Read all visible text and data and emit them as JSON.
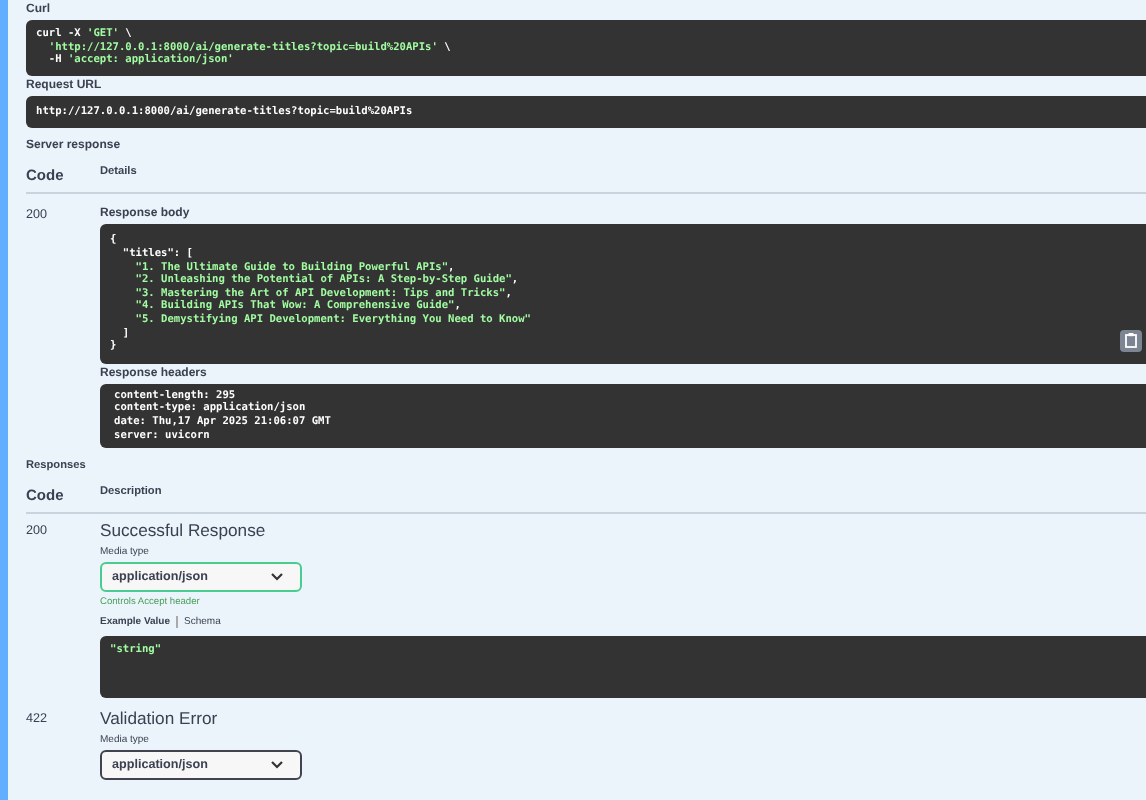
{
  "curl": {
    "label": "Curl",
    "lines": [
      [
        {
          "text": "curl -X ",
          "kind": "plain"
        },
        {
          "text": "'GET'",
          "kind": "string"
        },
        {
          "text": " \\",
          "kind": "plain"
        }
      ],
      [
        {
          "text": "  'http://127.0.0.1:8000/ai/generate-titles?topic=build%20APIs'",
          "kind": "string"
        },
        {
          "text": " \\",
          "kind": "plain"
        }
      ],
      [
        {
          "text": "  -H ",
          "kind": "plain"
        },
        {
          "text": "'accept: application/json'",
          "kind": "string"
        }
      ]
    ]
  },
  "request_url": {
    "label": "Request URL",
    "value": "http://127.0.0.1:8000/ai/generate-titles?topic=build%20APIs"
  },
  "server_response": {
    "label": "Server response",
    "columns": [
      "Code",
      "Details"
    ],
    "code": "200",
    "body_label": "Response body",
    "body_lines": [
      [
        {
          "text": "{",
          "kind": "plain"
        }
      ],
      [
        {
          "text": "  \"titles\": [",
          "kind": "plain"
        }
      ],
      [
        {
          "text": "    \"1. The Ultimate Guide to Building Powerful APIs\"",
          "kind": "string"
        },
        {
          "text": ",",
          "kind": "plain"
        }
      ],
      [
        {
          "text": "    \"2. Unleashing the Potential of APIs: A Step-by-Step Guide\"",
          "kind": "string"
        },
        {
          "text": ",",
          "kind": "plain"
        }
      ],
      [
        {
          "text": "    \"3. Mastering the Art of API Development: Tips and Tricks\"",
          "kind": "string"
        },
        {
          "text": ",",
          "kind": "plain"
        }
      ],
      [
        {
          "text": "    \"4. Building APIs That Wow: A Comprehensive Guide\"",
          "kind": "string"
        },
        {
          "text": ",",
          "kind": "plain"
        }
      ],
      [
        {
          "text": "    \"5. Demystifying API Development: Everything You Need to Know\"",
          "kind": "string"
        }
      ],
      [
        {
          "text": "  ]",
          "kind": "plain"
        }
      ],
      [
        {
          "text": "}",
          "kind": "plain"
        }
      ]
    ],
    "headers_label": "Response headers",
    "headers": [
      "content-length: 295",
      "content-type: application/json",
      "date: Thu,17 Apr 2025 21:06:07 GMT",
      "server: uvicorn"
    ]
  },
  "responses": {
    "label": "Responses",
    "columns": [
      "Code",
      "Description"
    ],
    "items": [
      {
        "code": "200",
        "description": "Successful Response",
        "media_label": "Media type",
        "media_value": "application/json",
        "focused": true,
        "hint": "Controls Accept header",
        "tabs": [
          {
            "label": "Example Value",
            "selected": true
          },
          {
            "label": "Schema",
            "selected": false
          }
        ],
        "example": "\"string\""
      },
      {
        "code": "422",
        "description": "Validation Error",
        "media_label": "Media type",
        "media_value": "application/json",
        "focused": false
      }
    ]
  }
}
